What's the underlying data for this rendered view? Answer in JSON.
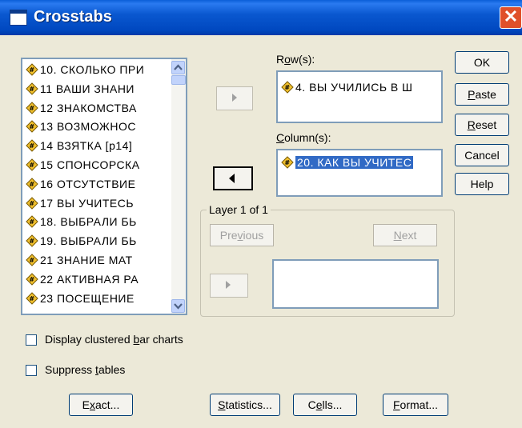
{
  "window": {
    "title": "Crosstabs"
  },
  "variables": [
    "10. СКОЛЬКО ПРИ",
    "11  ВАШИ ЗНАНИ",
    "12  ЗНАКОМСТВА",
    "13 ВОЗМОЖНОС",
    "14 ВЗЯТКА [p14]",
    "15 СПОНСОРСКА",
    "16 ОТСУТСТВИЕ",
    "17   ВЫ УЧИТЕСЬ",
    "18. ВЫБРАЛИ БЬ",
    "19. ВЫБРАЛИ БЬ",
    "21  ЗНАНИЕ МАТ",
    "22 АКТИВНАЯ РА",
    "23 ПОСЕЩЕНИЕ"
  ],
  "rows": {
    "label": "Row(s):",
    "items": [
      "4. ВЫ УЧИЛИСЬ В Ш"
    ]
  },
  "columns": {
    "label": "Column(s):",
    "items": [
      "20. КАК ВЫ УЧИТЕС"
    ]
  },
  "layer": {
    "title": "Layer 1 of 1",
    "previous": "Previous",
    "next": "Next"
  },
  "buttons": {
    "ok": "OK",
    "paste": "Paste",
    "reset": "Reset",
    "cancel": "Cancel",
    "help": "Help",
    "exact": "Exact...",
    "statistics": "Statistics...",
    "cells": "Cells...",
    "format": "Format..."
  },
  "options": {
    "clustered_bar": "Display clustered bar charts",
    "suppress_tables": "Suppress tables"
  },
  "title_close": "✕"
}
